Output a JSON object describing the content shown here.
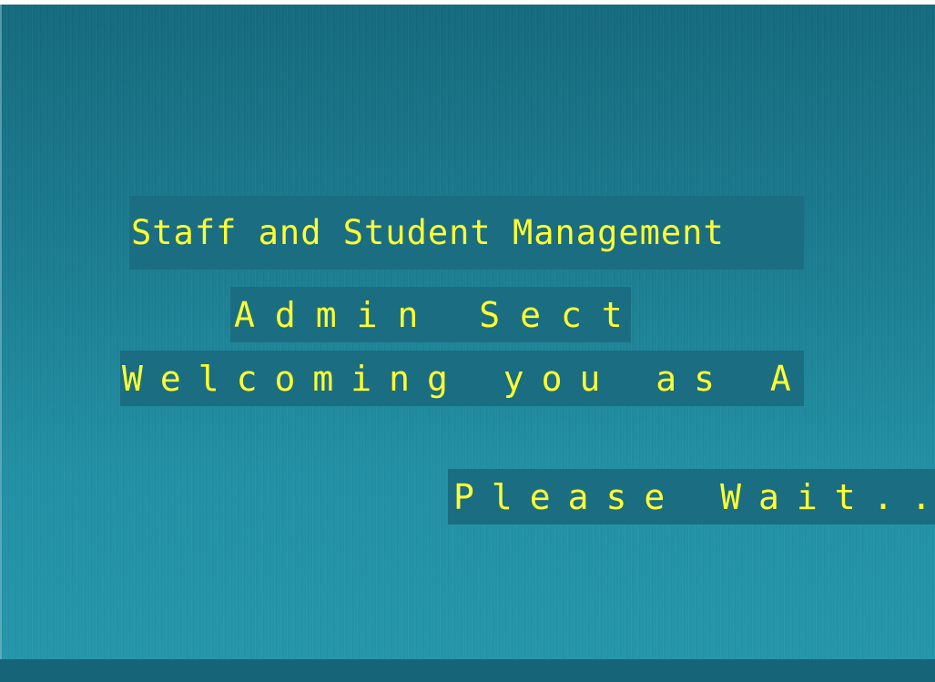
{
  "app": {
    "title": "Staff and Student Management",
    "section": "Admin Section",
    "welcome": "Welcoming you as Admin",
    "status": "Please Wait....."
  },
  "colors": {
    "background": "#1a7b8f",
    "label_background": "#1b6d82",
    "text": "#ffff33"
  }
}
